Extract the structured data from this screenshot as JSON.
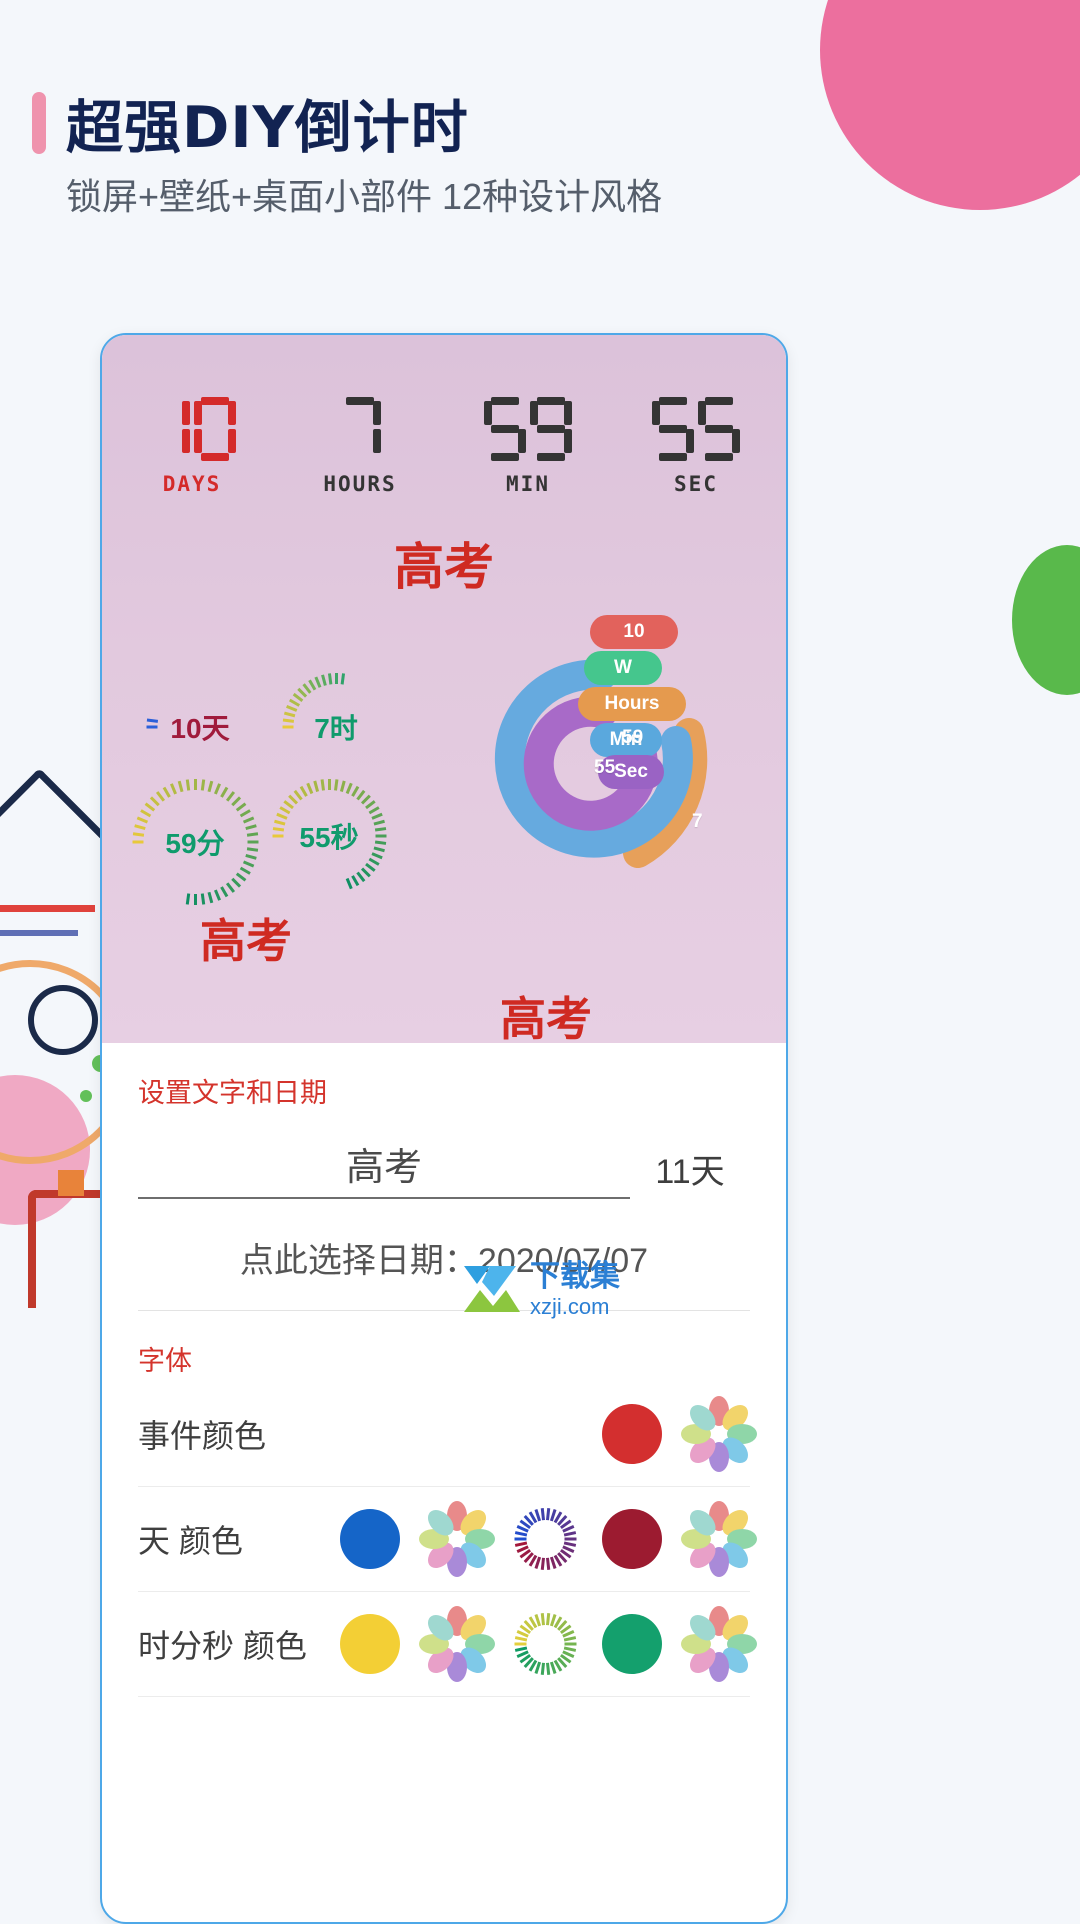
{
  "header": {
    "title": "超强DIY倒计时",
    "subtitle": "锁屏+壁纸+桌面小部件 12种设计风格",
    "accent_bar_color": "#ef93ad",
    "title_color": "#122352"
  },
  "preview": {
    "background_color": "#e0c6dd",
    "lcd": {
      "columns": [
        {
          "value": "10",
          "label": "DAYS",
          "color": "#d42a2a"
        },
        {
          "value": "7",
          "label": "HOURS",
          "color": "#343434"
        },
        {
          "value": "59",
          "label": "MIN",
          "color": "#343434"
        },
        {
          "value": "55",
          "label": "SEC",
          "color": "#343434"
        }
      ]
    },
    "event_titles": {
      "top": "高考",
      "middle": "高考",
      "bottom": "高考",
      "color": "#cf2a22"
    },
    "ring_widgets": [
      {
        "name": "days-ring",
        "label": "10天",
        "label_color": "#a01b3c",
        "tick_from": "#2b5fd9",
        "tick_to": "#2b5fd9",
        "tick_count": 2
      },
      {
        "name": "hours-ring",
        "label": "7时",
        "label_color": "#0f9b6c",
        "tick_from": "#e8c93a",
        "tick_to": "#2fa36b",
        "tick_count": 14
      },
      {
        "name": "min-ring",
        "label": "59分",
        "label_color": "#0f9b6c",
        "tick_from": "#e8c93a",
        "tick_to": "#0f8f63",
        "tick_count": 38
      },
      {
        "name": "sec-ring",
        "label": "55秒",
        "label_color": "#0f9b6c",
        "tick_from": "#e8c93a",
        "tick_to": "#0f8f63",
        "tick_count": 34
      }
    ],
    "donut": {
      "pills": [
        {
          "label": "10",
          "color": "#e2625c"
        },
        {
          "label": "W",
          "color": "#45c68d"
        },
        {
          "label": "Hours",
          "color": "#e59a4e"
        },
        {
          "label": "Min",
          "color": "#5aa8dd"
        },
        {
          "label": "Sec",
          "color": "#9a63c4"
        }
      ],
      "arc_values": [
        {
          "label": "59",
          "color": "#5aa8dd"
        },
        {
          "label": "55",
          "color": "#9a63c4"
        },
        {
          "label": "7",
          "color": "#e59a4e"
        }
      ]
    }
  },
  "settings": {
    "section_text_date": "设置文字和日期",
    "event_name_value": "高考",
    "days_remaining": "11天",
    "date_row": "点此选择日期：2020/07/07",
    "section_font": "字体",
    "color_rows": [
      {
        "label": "事件颜色",
        "swatches": [
          {
            "type": "dot",
            "color": "#d32f2f"
          },
          {
            "type": "flower"
          }
        ]
      },
      {
        "label": "天 颜色",
        "swatches": [
          {
            "type": "dot",
            "color": "#1565c8"
          },
          {
            "type": "flower"
          },
          {
            "type": "ring",
            "from": "#1f4fd0",
            "to": "#a3173a"
          },
          {
            "type": "dot",
            "color": "#9c1b30"
          },
          {
            "type": "flower"
          }
        ]
      },
      {
        "label": "时分秒 颜色",
        "swatches": [
          {
            "type": "dot",
            "color": "#f3cf35"
          },
          {
            "type": "flower"
          },
          {
            "type": "ring",
            "from": "#e3cf3c",
            "to": "#0f9b63"
          },
          {
            "type": "dot",
            "color": "#14a06d"
          },
          {
            "type": "flower"
          }
        ]
      }
    ]
  },
  "watermark": {
    "cn": "下载集",
    "en": "xzji.com",
    "color": "#2b7fd4"
  }
}
